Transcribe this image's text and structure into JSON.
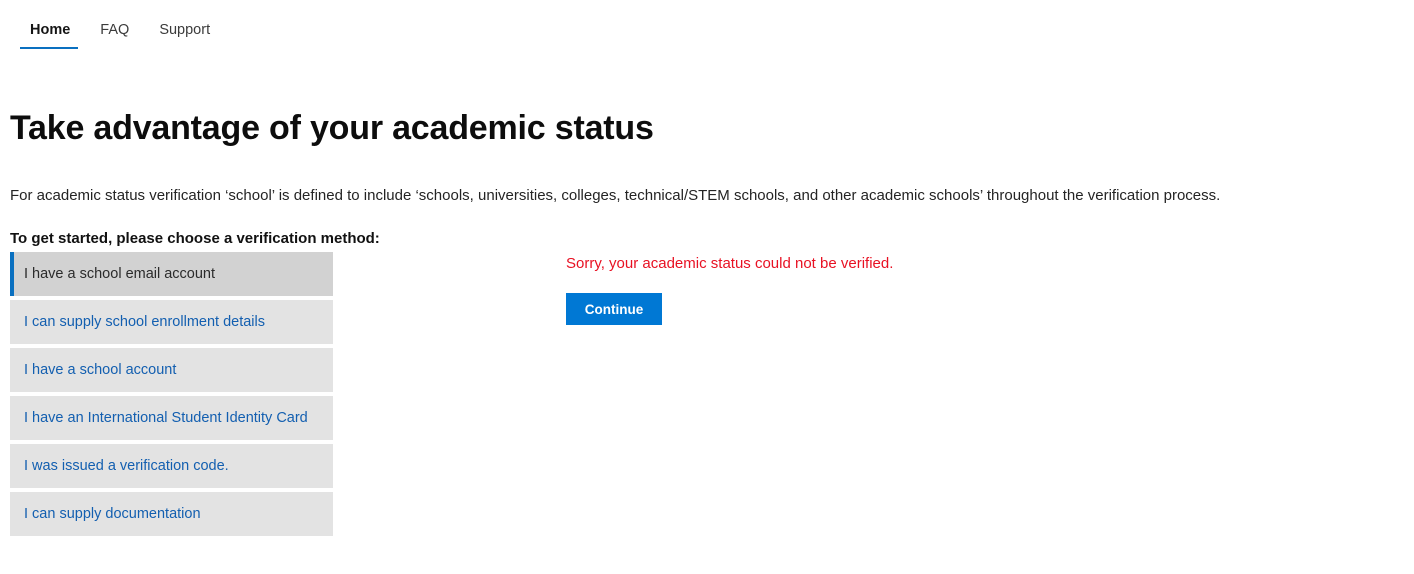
{
  "nav": {
    "items": [
      {
        "label": "Home",
        "active": true
      },
      {
        "label": "FAQ",
        "active": false
      },
      {
        "label": "Support",
        "active": false
      }
    ]
  },
  "page": {
    "title": "Take advantage of your academic status",
    "intro": "For academic status verification ‘school’ is defined to include ‘schools, universities, colleges, technical/STEM schools, and other academic schools’ throughout the verification process.",
    "prompt": "To get started, please choose a verification method:"
  },
  "methods": {
    "items": [
      {
        "label": "I have a school email account",
        "selected": true
      },
      {
        "label": "I can supply school enrollment details",
        "selected": false
      },
      {
        "label": "I have a school account",
        "selected": false
      },
      {
        "label": "I have an International Student Identity Card",
        "selected": false
      },
      {
        "label": "I was issued a verification code.",
        "selected": false
      },
      {
        "label": "I can supply documentation",
        "selected": false
      }
    ]
  },
  "result": {
    "error_message": "Sorry, your academic status could not be verified.",
    "continue_label": "Continue"
  },
  "colors": {
    "accent_blue": "#0078d4",
    "nav_underline": "#0a70c0",
    "link_blue": "#135fb0",
    "error_red": "#e81123",
    "item_background": "#e3e3e3",
    "item_selected_background": "#d2d2d2"
  }
}
